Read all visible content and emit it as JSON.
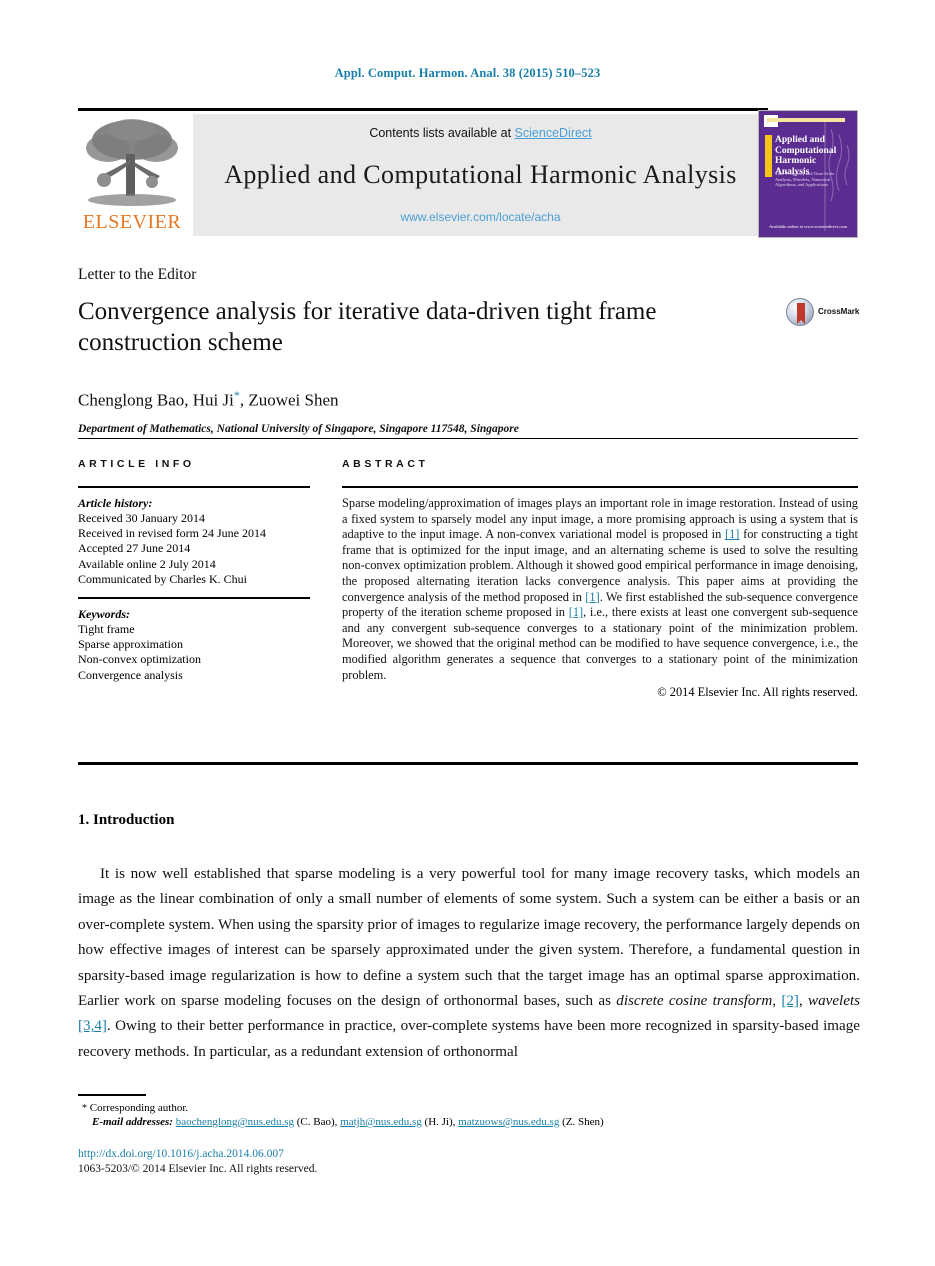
{
  "running_head": "Appl. Comput. Harmon. Anal. 38 (2015) 510–523",
  "masthead": {
    "contents_prefix": "Contents lists available at ",
    "sciencedirect": "ScienceDirect",
    "journal_title": "Applied and Computational Harmonic Analysis",
    "journal_url": "www.elsevier.com/locate/acha",
    "publisher": "ELSEVIER",
    "cover": {
      "title": "Applied and Computational Harmonic Analysis",
      "subtitle": "Time-Frequency and Time-Scale Analysis, Wavelets, Numerical Algorithms, and Applications",
      "footer": "Available online at www.sciencedirect.com"
    },
    "colors": {
      "link": "#4a9fd4",
      "elsevier_orange": "#E87722",
      "cover_purple": "#5c2d91"
    }
  },
  "title_block": {
    "article_type": "Letter to the Editor",
    "title": "Convergence analysis for iterative data-driven tight frame construction scheme",
    "authors": "Chenglong Bao, Hui Ji",
    "authors_tail": ", Zuowei Shen",
    "corresponding_marker": "*",
    "affiliation": "Department of Mathematics, National University of Singapore, Singapore 117548, Singapore",
    "crossmark_label": "CrossMark"
  },
  "article_info": {
    "heading": "ARTICLE INFO",
    "history_label": "Article history:",
    "history": [
      "Received 30 January 2014",
      "Received in revised form 24 June 2014",
      "Accepted 27 June 2014",
      "Available online 2 July 2014",
      "Communicated by Charles K. Chui"
    ],
    "keywords_label": "Keywords:",
    "keywords": [
      "Tight frame",
      "Sparse approximation",
      "Non-convex optimization",
      "Convergence analysis"
    ]
  },
  "abstract": {
    "heading": "ABSTRACT",
    "part1": "Sparse modeling/approximation of images plays an important role in image restoration. Instead of using a fixed system to sparsely model any input image, a more promising approach is using a system that is adaptive to the input image. A non-convex variational model is proposed in ",
    "cite1": "[1]",
    "part2": " for constructing a tight frame that is optimized for the input image, and an alternating scheme is used to solve the resulting non-convex optimization problem. Although it showed good empirical performance in image denoising, the proposed alternating iteration lacks convergence analysis. This paper aims at providing the convergence analysis of the method proposed in ",
    "cite2": "[1]",
    "part3": ". We first established the sub-sequence convergence property of the iteration scheme proposed in ",
    "cite3": "[1]",
    "part4": ", i.e., there exists at least one convergent sub-sequence and any convergent sub-sequence converges to a stationary point of the minimization problem. Moreover, we showed that the original method can be modified to have sequence convergence, i.e., the modified algorithm generates a sequence that converges to a stationary point of the minimization problem.",
    "copyright": "© 2014 Elsevier Inc. All rights reserved."
  },
  "introduction": {
    "heading": "1. Introduction",
    "p1_a": "It is now well established that sparse modeling is a very powerful tool for many image recovery tasks, which models an image as the linear combination of only a small number of elements of some system. Such a system can be either a basis or an over-complete system. When using the sparsity prior of images to regularize image recovery, the performance largely depends on how effective images of interest can be sparsely approximated under the given system. Therefore, a fundamental question in sparsity-based image regularization is how to define a system such that the target image has an optimal sparse approximation. Earlier work on sparse modeling focuses on the design of orthonormal bases, such as ",
    "dct": "discrete cosine transform",
    "cite_dct": "[2]",
    "p1_b": ", ",
    "wavelets": "wavelets",
    "cite_wav": "[3,4]",
    "p1_c": ". Owing to their better performance in practice, over-complete systems have been more recognized in sparsity-based image recovery methods. In particular, as a redundant extension of orthonormal"
  },
  "footer": {
    "corresponding_star": "*",
    "corresponding_text": "Corresponding author.",
    "email_label": "E-mail addresses:",
    "emails": [
      {
        "address": "baochenglong@nus.edu.sg",
        "owner": "(C. Bao)"
      },
      {
        "address": "matjh@nus.edu.sg",
        "owner": "(H. Ji)"
      },
      {
        "address": "matzuows@nus.edu.sg",
        "owner": "(Z. Shen)"
      }
    ],
    "doi": "http://dx.doi.org/10.1016/j.acha.2014.06.007",
    "issn": "1063-5203/© 2014 Elsevier Inc. All rights reserved."
  }
}
